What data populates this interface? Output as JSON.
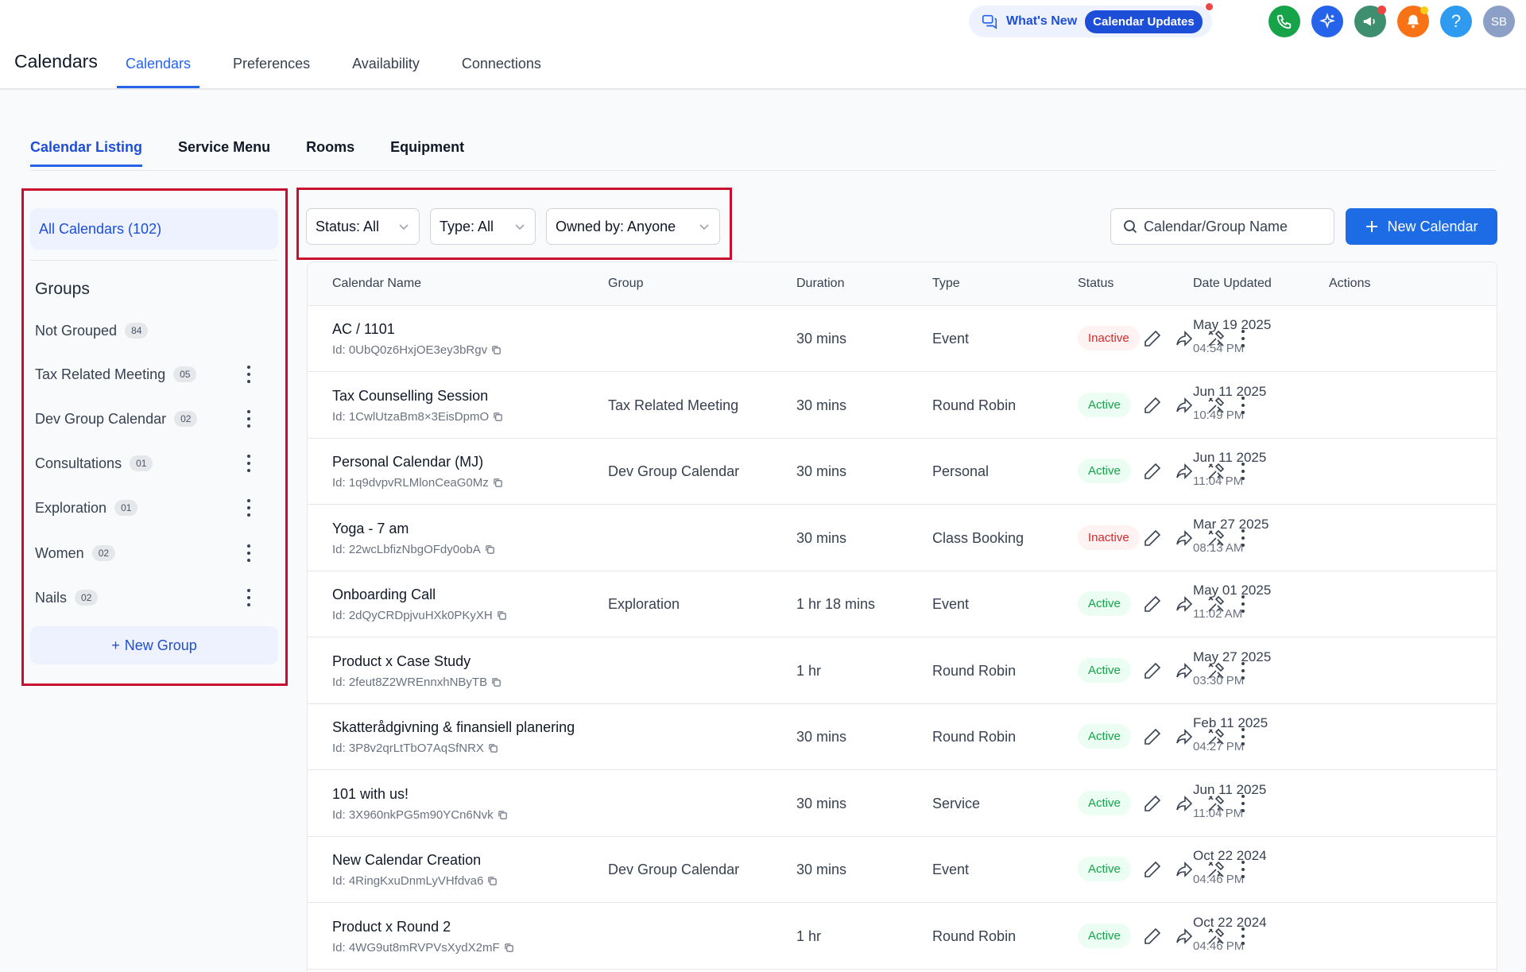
{
  "header": {
    "app_title": "Calendars",
    "tabs": [
      {
        "label": "Calendars",
        "active": true
      },
      {
        "label": "Preferences",
        "active": false
      },
      {
        "label": "Availability",
        "active": false
      },
      {
        "label": "Connections",
        "active": false
      }
    ],
    "whats_new": {
      "label": "What's New",
      "pill": "Calendar Updates"
    },
    "avatar_initials": "SB",
    "icon_buttons": [
      {
        "icon": "phone-icon",
        "color": "#16a34a"
      },
      {
        "icon": "sparkle-icon",
        "color": "#2563eb"
      },
      {
        "icon": "megaphone-icon",
        "color": "#3d8f6f"
      },
      {
        "icon": "bell-icon",
        "color": "#f97316"
      },
      {
        "icon": "help-icon",
        "color": "#2f9bf0"
      }
    ]
  },
  "subtabs": [
    {
      "label": "Calendar Listing",
      "active": true
    },
    {
      "label": "Service Menu",
      "active": false
    },
    {
      "label": "Rooms",
      "active": false
    },
    {
      "label": "Equipment",
      "active": false
    }
  ],
  "sidebar": {
    "all_calendars": "All Calendars (102)",
    "groups_heading": "Groups",
    "groups": [
      {
        "name": "Not Grouped",
        "count": "84",
        "menu": false
      },
      {
        "name": "Tax Related Meeting",
        "count": "05",
        "menu": true
      },
      {
        "name": "Dev Group Calendar",
        "count": "02",
        "menu": true
      },
      {
        "name": "Consultations",
        "count": "01",
        "menu": true
      },
      {
        "name": "Exploration",
        "count": "01",
        "menu": true
      },
      {
        "name": "Women",
        "count": "02",
        "menu": true
      },
      {
        "name": "Nails",
        "count": "02",
        "menu": true
      }
    ],
    "new_group": "New Group"
  },
  "filters": {
    "status": "Status: All",
    "type": "Type: All",
    "owner": "Owned by: Anyone"
  },
  "search": {
    "placeholder": "Calendar/Group Name"
  },
  "new_calendar": "New Calendar",
  "table": {
    "headers": {
      "name": "Calendar Name",
      "group": "Group",
      "duration": "Duration",
      "type": "Type",
      "status": "Status",
      "date": "Date Updated",
      "actions": "Actions"
    },
    "rows": [
      {
        "name": "AC / 1101",
        "id": "Id: 0UbQ0z6HxjOE3ey3bRgv",
        "group": "",
        "duration": "30 mins",
        "type": "Event",
        "status": "Inactive",
        "date": "May 19 2025",
        "time": "04:54 PM"
      },
      {
        "name": "Tax Counselling Session",
        "id": "Id: 1CwlUtzaBm8×3EisDpmO",
        "group": "Tax Related Meeting",
        "duration": "30 mins",
        "type": "Round Robin",
        "status": "Active",
        "date": "Jun 11 2025",
        "time": "10:49 PM"
      },
      {
        "name": "Personal Calendar (MJ)",
        "id": "Id: 1q9dvpvRLMlonCeaG0Mz",
        "group": "Dev Group Calendar",
        "duration": "30 mins",
        "type": "Personal",
        "status": "Active",
        "date": "Jun 11 2025",
        "time": "11:04 PM"
      },
      {
        "name": "Yoga - 7 am",
        "id": "Id: 22wcLbfizNbgOFdy0obA",
        "group": "",
        "duration": "30 mins",
        "type": "Class Booking",
        "status": "Inactive",
        "date": "Mar 27 2025",
        "time": "08:13 AM"
      },
      {
        "name": "Onboarding Call",
        "id": "Id: 2dQyCRDpjvuHXk0PKyXH",
        "group": "Exploration",
        "duration": "1 hr 18 mins",
        "type": "Event",
        "status": "Active",
        "date": "May 01 2025",
        "time": "11:02 AM"
      },
      {
        "name": "Product x Case Study",
        "id": "Id: 2feut8Z2WREnnxhNByTB",
        "group": "",
        "duration": "1 hr",
        "type": "Round Robin",
        "status": "Active",
        "date": "May 27 2025",
        "time": "03:30 PM"
      },
      {
        "name": "Skatterådgivning & finansiell planering",
        "id": "Id: 3P8v2qrLtTbO7AqSfNRX",
        "group": "",
        "duration": "30 mins",
        "type": "Round Robin",
        "status": "Active",
        "date": "Feb 11 2025",
        "time": "04:27 PM"
      },
      {
        "name": "101 with us!",
        "id": "Id: 3X960nkPG5m90YCn6Nvk",
        "group": "",
        "duration": "30 mins",
        "type": "Service",
        "status": "Active",
        "date": "Jun 11 2025",
        "time": "11:04 PM"
      },
      {
        "name": "New Calendar Creation",
        "id": "Id: 4RingKxuDnmLyVHfdva6",
        "group": "Dev Group Calendar",
        "duration": "30 mins",
        "type": "Event",
        "status": "Active",
        "date": "Oct 22 2024",
        "time": "04:46 PM"
      },
      {
        "name": "Product x Round 2",
        "id": "Id: 4WG9ut8mRVPVsXydX2mF",
        "group": "",
        "duration": "1 hr",
        "type": "Round Robin",
        "status": "Active",
        "date": "Oct 22 2024",
        "time": "04:46 PM"
      }
    ]
  }
}
